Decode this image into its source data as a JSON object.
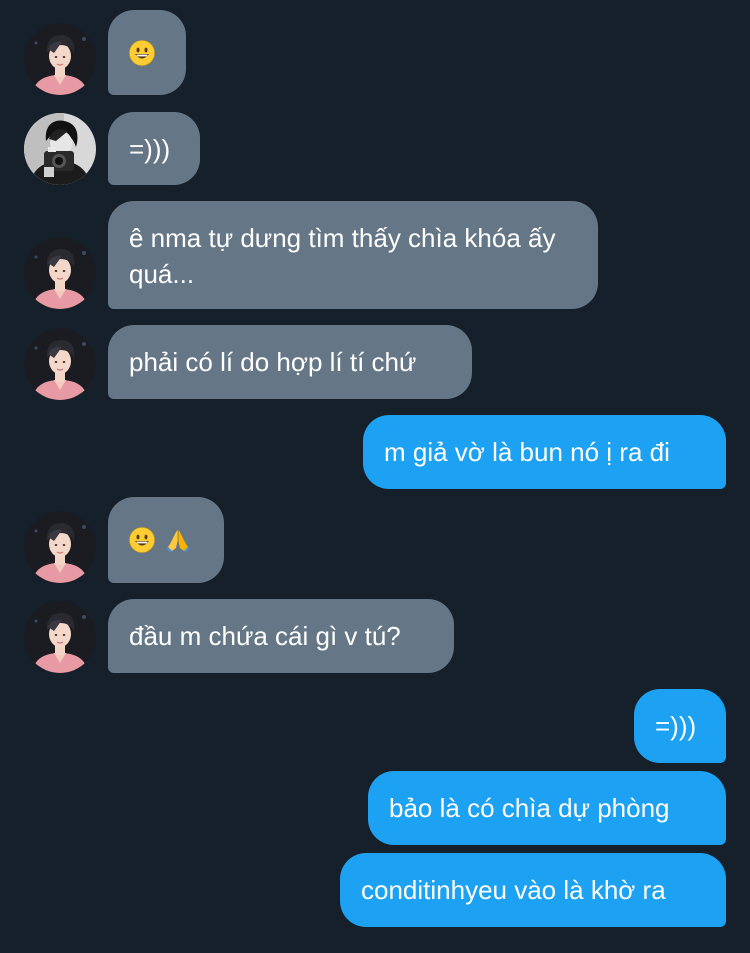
{
  "conversation": {
    "messages": [
      {
        "id": "m1",
        "side": "received",
        "avatar": "pink-avatar",
        "emojis": [
          "grinning-face"
        ]
      },
      {
        "id": "m2",
        "side": "received",
        "avatar": "bw-camera-avatar",
        "text": "=)))"
      },
      {
        "id": "m3",
        "side": "received",
        "avatar": "pink-avatar",
        "text": "ê nma tự dưng tìm thấy chìa khóa ấy quá..."
      },
      {
        "id": "m4",
        "side": "received",
        "avatar": "pink-avatar",
        "text": "phải có lí do hợp lí tí chứ"
      },
      {
        "id": "m5",
        "side": "sent",
        "text": "m giả vờ là bun nó ị ra đi"
      },
      {
        "id": "m6",
        "side": "received",
        "avatar": "pink-avatar",
        "emojis": [
          "grinning-face",
          "folded-hands"
        ]
      },
      {
        "id": "m7",
        "side": "received",
        "avatar": "pink-avatar",
        "text": "đầu m chứa cái gì v tú?"
      },
      {
        "id": "m8",
        "side": "sent",
        "text": "=)))"
      },
      {
        "id": "m9",
        "side": "sent",
        "text": "bảo là có chìa dự phòng"
      },
      {
        "id": "m10",
        "side": "sent",
        "text": "conditinhyeu vào là khờ ra"
      }
    ]
  },
  "colors": {
    "background": "#15202b",
    "received_bubble": "#657786",
    "sent_bubble": "#1da1f2",
    "text": "#ffffff"
  }
}
